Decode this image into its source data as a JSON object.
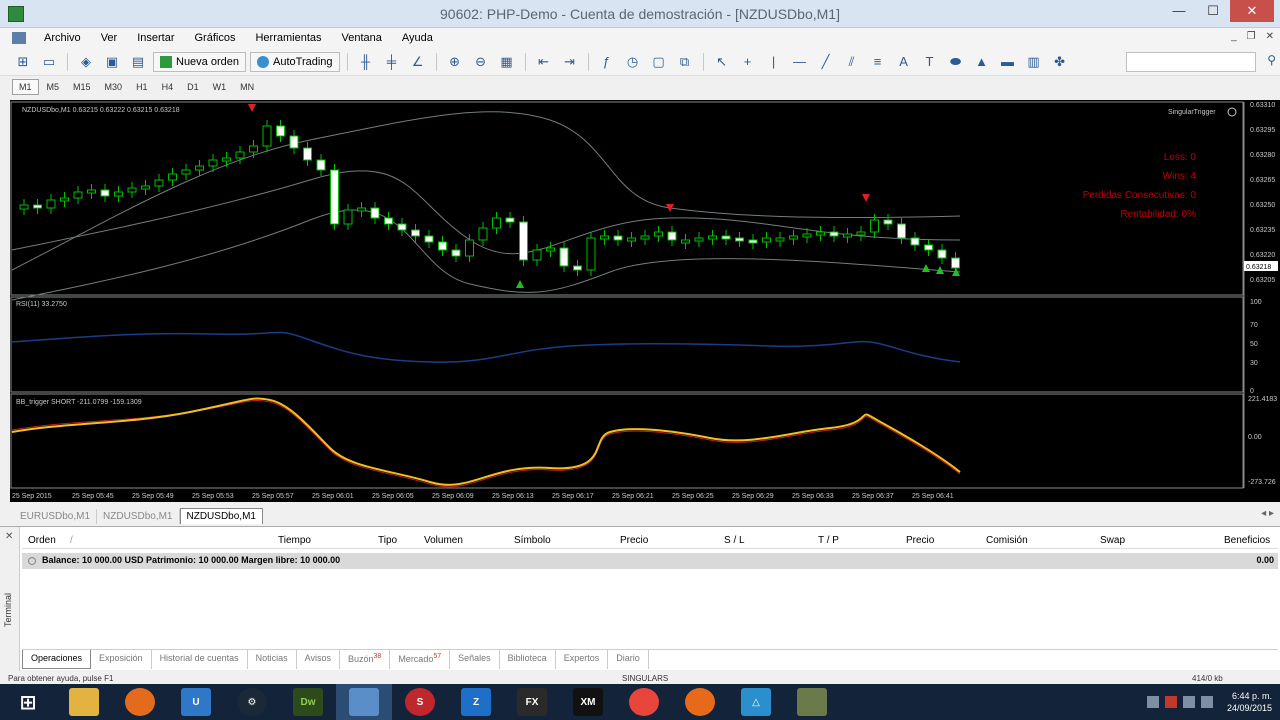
{
  "window": {
    "title": "90602: PHP-Demo - Cuenta de demostración - [NZDUSDbo,M1]"
  },
  "menu": [
    "Archivo",
    "Ver",
    "Insertar",
    "Gráficos",
    "Herramientas",
    "Ventana",
    "Ayuda"
  ],
  "toolbar": {
    "new_order": "Nueva orden",
    "autotrading": "AutoTrading"
  },
  "timeframes": [
    "M1",
    "M5",
    "M15",
    "M30",
    "H1",
    "H4",
    "D1",
    "W1",
    "MN"
  ],
  "active_timeframe": "M1",
  "chart": {
    "header": "NZDUSDbo,M1  0.63215 0.63222 0.63215 0.63218",
    "expert_name": "SingularTrigger",
    "current_price": "0.63218",
    "stats": [
      "Loss: 0",
      "Wins: 4",
      "Perdidas Consecutivas: 0",
      "Rentabilidad: 0%"
    ],
    "rsi_label": "RSI(11) 33.2750",
    "bb_label": "BB_trigger SHORT -211.0799 -159.1309",
    "price_ticks": [
      "0.63310",
      "0.63295",
      "0.63280",
      "0.63265",
      "0.63250",
      "0.63235",
      "0.63220",
      "0.63205"
    ],
    "rsi_ticks": [
      "100",
      "70",
      "50",
      "30",
      "0"
    ],
    "bb_ticks": [
      "221.4183",
      "0.00",
      "-273.726"
    ],
    "time_ticks": [
      "25 Sep 2015",
      "25 Sep 05:45",
      "25 Sep 05:49",
      "25 Sep 05:53",
      "25 Sep 05:57",
      "25 Sep 06:01",
      "25 Sep 06:05",
      "25 Sep 06:09",
      "25 Sep 06:13",
      "25 Sep 06:17",
      "25 Sep 06:21",
      "25 Sep 06:25",
      "25 Sep 06:29",
      "25 Sep 06:33",
      "25 Sep 06:37",
      "25 Sep 06:41"
    ]
  },
  "chart_tabs": [
    "EURUSDbo,M1",
    "NZDUSDbo,M1",
    "NZDUSDbo,M1"
  ],
  "terminal": {
    "side_label": "Terminal",
    "columns": [
      "Orden",
      "Tiempo",
      "Tipo",
      "Volumen",
      "Símbolo",
      "Precio",
      "S / L",
      "T / P",
      "Precio",
      "Comisión",
      "Swap",
      "Beneficios"
    ],
    "balance_row": "Balance: 10 000.00 USD  Patrimonio: 10 000.00  Margen libre: 10 000.00",
    "balance_value": "0.00",
    "tabs": [
      "Operaciones",
      "Exposición",
      "Historial de cuentas",
      "Noticias",
      "Avisos",
      "Buzón",
      "Mercado",
      "Señales",
      "Biblioteca",
      "Expertos",
      "Diario"
    ],
    "buzon_badge": "38",
    "mercado_badge": "57"
  },
  "status": {
    "help": "Para obtener ayuda, pulse F1",
    "profile": "SINGULARS",
    "traffic": "414/0 kb"
  },
  "taskbar": {
    "apps": [
      "Internet Explorer",
      "Folder",
      "Location",
      "Outlook",
      "Steam",
      "Dreamweaver",
      "Files",
      "Scissors",
      "Z",
      "FX",
      "XM",
      "Chrome",
      "Firefox",
      "App",
      "Terminal"
    ],
    "time": "6:44 p. m.",
    "date": "24/09/2015"
  },
  "colors": {
    "candle_up": "#00c000",
    "candle_body": "#ffffff",
    "bands": "#6f7f7f",
    "rsi": "#1a3d8a",
    "bb_line": "#f0c020",
    "bb_signal": "#c02020",
    "arrow_down": "#e02020",
    "arrow_up": "#20c020"
  }
}
